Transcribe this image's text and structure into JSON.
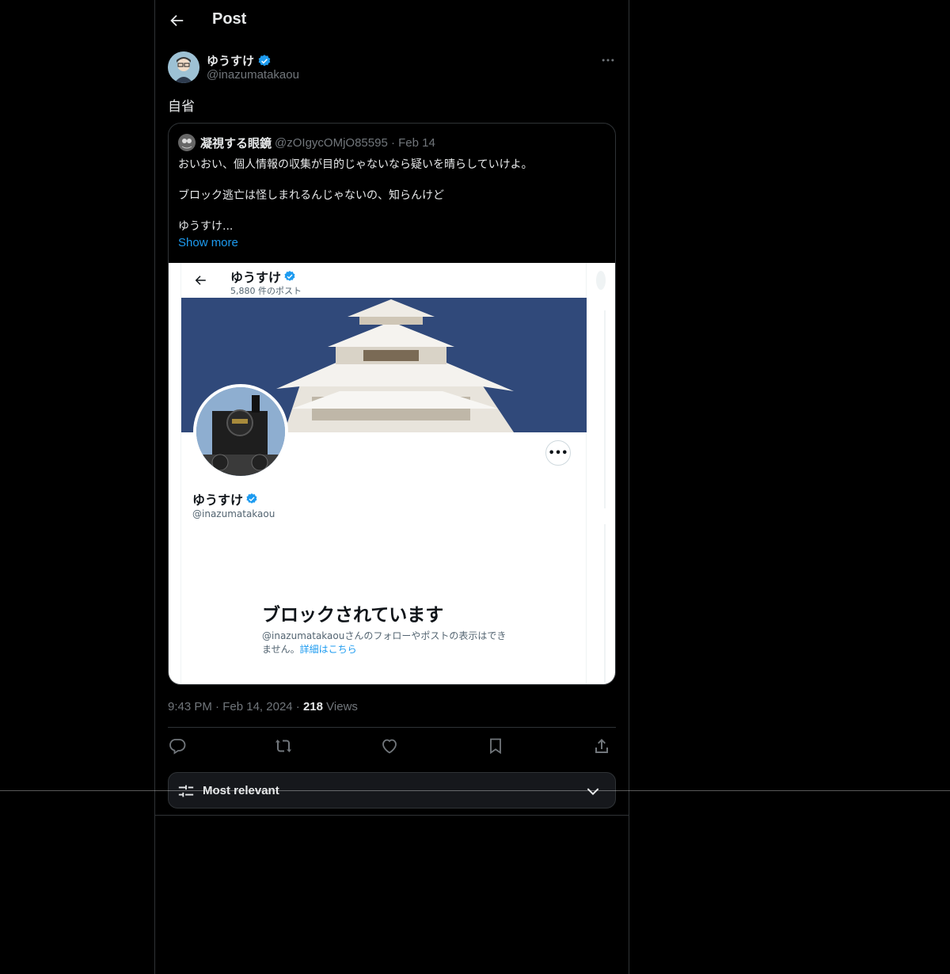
{
  "header": {
    "title": "Post"
  },
  "post": {
    "author_name": "ゆうすけ",
    "author_handle": "@inazumatakaou",
    "text": "自省",
    "time": "9:43 PM",
    "date": "Feb 14, 2024",
    "views_count": "218",
    "views_label": "Views"
  },
  "quote": {
    "name": "凝視する眼鏡",
    "handle": "@zOIgycOMjO85595",
    "date": "Feb 14",
    "lines": [
      "おいおい、個人情報の収集が目的じゃないなら疑いを晴らしていけよ。",
      "ブロック逃亡は怪しまれるんじゃないの、知らんけど",
      "ゆうすけ..."
    ],
    "show_more": "Show more"
  },
  "embed": {
    "name": "ゆうすけ",
    "post_count": "5,880 件のポスト",
    "more": "•••",
    "handle": "@inazumatakaou",
    "blocked_title": "ブロックされています",
    "blocked_desc": "@inazumatakaouさんのフォローやポストの表示はできません。",
    "blocked_link": "詳細はこちら"
  },
  "sort": {
    "label": "Most relevant"
  },
  "icons": [
    "arrow-left-icon",
    "verified-badge-icon",
    "more-icon",
    "reply-icon",
    "retweet-icon",
    "like-icon",
    "bookmark-icon",
    "share-icon",
    "sliders-icon",
    "chevron-down-icon"
  ],
  "colors": {
    "background": "#000000",
    "accent": "#1d9bf0",
    "text": "#e7e9ea",
    "muted": "#71767b",
    "border": "#2f3336"
  }
}
